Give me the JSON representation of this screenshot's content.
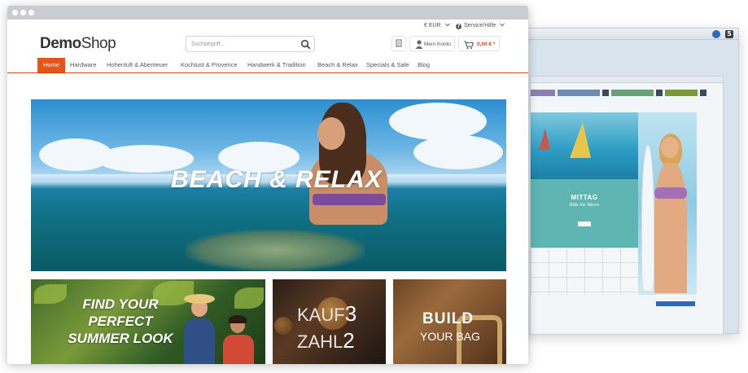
{
  "currency": {
    "label": "€ EUR",
    "chevron": "chevron-down-icon"
  },
  "service": {
    "label": "Service/Hilfe",
    "icon": "question-circle-icon"
  },
  "logo": {
    "demo": "Demo",
    "shop": "Shop"
  },
  "search": {
    "placeholder": "Suchbegriff...",
    "icon": "search-icon"
  },
  "account": {
    "label": "Mein Konto",
    "icon": "user-icon"
  },
  "notepad": {
    "icon": "notepad-icon"
  },
  "cart": {
    "amount": "0,00 € *",
    "icon": "cart-icon"
  },
  "nav": {
    "items": [
      "Home",
      "Hardware",
      "Hohenluft & Abenteuer",
      "Kochlust & Provence",
      "Handwerk & Tradition",
      "Beach & Relax",
      "Specials & Sale",
      "Blog"
    ],
    "active": "Home"
  },
  "hero": {
    "title": "BEACH & RELAX"
  },
  "teasers": {
    "summer": {
      "line1": "FIND YOUR",
      "line2": "PERFECT",
      "line3": "SUMMER LOOK"
    },
    "kauf": {
      "word1": "KAUF",
      "num1": "3",
      "word2": "ZAHL",
      "num2": "2"
    },
    "bag": {
      "line1": "BUILD",
      "line2": "YOUR BAG"
    }
  },
  "backend": {
    "teal_title": "MITTAG",
    "teal_subtitle": "Ride the Waves",
    "close_glyph": "5"
  },
  "colors": {
    "accent": "#e4551d",
    "teal": "#5fb5b2",
    "backend_blue": "#2a6ab7"
  }
}
